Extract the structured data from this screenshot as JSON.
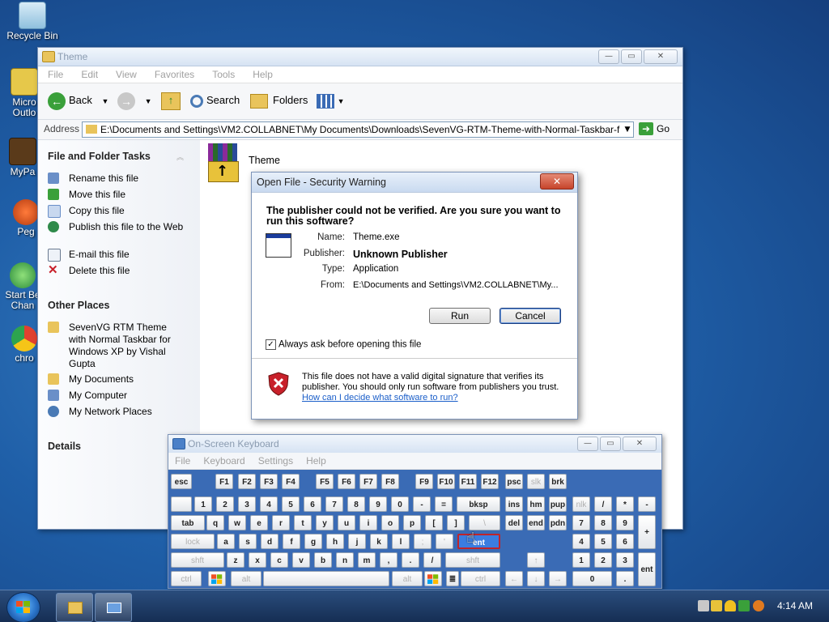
{
  "desktop": {
    "icons": [
      {
        "label": "Recycle Bin"
      },
      {
        "label": "Micro"
      },
      {
        "label": "Outlo"
      },
      {
        "label": "MyPa"
      },
      {
        "label": "Peg"
      },
      {
        "label": "Start Be"
      },
      {
        "label": "Chan"
      },
      {
        "label": "chro"
      }
    ]
  },
  "explorer": {
    "title": "Theme",
    "menu": [
      "File",
      "Edit",
      "View",
      "Favorites",
      "Tools",
      "Help"
    ],
    "toolbar": {
      "back": "Back",
      "search": "Search",
      "folders": "Folders"
    },
    "address": {
      "label": "Address",
      "path": "E:\\Documents and Settings\\VM2.COLLABNET\\My Documents\\Downloads\\SevenVG-RTM-Theme-with-Normal-Taskbar-f",
      "go": "Go"
    },
    "tasks": {
      "heading": "File and Folder Tasks",
      "items": [
        "Rename this file",
        "Move this file",
        "Copy this file",
        "Publish this file to the Web",
        "E-mail this file",
        "Delete this file"
      ]
    },
    "other_places": {
      "heading": "Other Places",
      "items": [
        "SevenVG RTM Theme with Normal Taskbar for Windows XP by Vishal Gupta",
        "My Documents",
        "My Computer",
        "My Network Places"
      ]
    },
    "details": {
      "heading": "Details"
    },
    "file": {
      "name": "Theme"
    }
  },
  "dialog": {
    "title": "Open File - Security Warning",
    "question": "The publisher could not be verified.  Are you sure you want to run this software?",
    "props": [
      {
        "key": "Name:",
        "value": "Theme.exe"
      },
      {
        "key": "Publisher:",
        "value": "Unknown Publisher"
      },
      {
        "key": "Type:",
        "value": "Application"
      },
      {
        "key": "From:",
        "value": "E:\\Documents and Settings\\VM2.COLLABNET\\My..."
      }
    ],
    "run": "Run",
    "cancel": "Cancel",
    "checkbox": "Always ask before opening this file",
    "checkbox_checked": true,
    "warning": "This file does not have a valid digital signature that verifies its publisher. You should only run software from publishers you trust.",
    "link": "How can I decide what software to run?"
  },
  "osk": {
    "title": "On-Screen Keyboard",
    "menu": [
      "File",
      "Keyboard",
      "Settings",
      "Help"
    ],
    "keys": {
      "esc": "esc",
      "f1": "F1",
      "f2": "F2",
      "f3": "F3",
      "f4": "F4",
      "f5": "F5",
      "f6": "F6",
      "f7": "F7",
      "f8": "F8",
      "f9": "F9",
      "f10": "F10",
      "f11": "F11",
      "f12": "F12",
      "psc": "psc",
      "slk": "slk",
      "brk": "brk",
      "n1": "1",
      "n2": "2",
      "n3": "3",
      "n4": "4",
      "n5": "5",
      "n6": "6",
      "n7": "7",
      "n8": "8",
      "n9": "9",
      "n0": "0",
      "minus": "-",
      "equals": "=",
      "bksp": "bksp",
      "ins": "ins",
      "hm": "hm",
      "pup": "pup",
      "nlk": "nlk",
      "slash": "/",
      "star": "*",
      "nminus": "-",
      "tab": "tab",
      "q": "q",
      "w": "w",
      "e": "e",
      "r": "r",
      "t": "t",
      "y": "y",
      "u": "u",
      "i": "i",
      "o": "o",
      "p": "p",
      "lbr": "[",
      "rbr": "]",
      "bslash": "\\",
      "del": "del",
      "end": "end",
      "pdn": "pdn",
      "k7": "7",
      "k8": "8",
      "k9": "9",
      "plus": "+",
      "lock": "lock",
      "a": "a",
      "s": "s",
      "d": "d",
      "f": "f",
      "g": "g",
      "h": "h",
      "j": "j",
      "k": "k",
      "l": "l",
      "semi": ";",
      "quote": "'",
      "ent_main": "ent",
      "k4": "4",
      "k5": "5",
      "k6": "6",
      "lshft": "shft",
      "z": "z",
      "x": "x",
      "c": "c",
      "v": "v",
      "b": "b",
      "n": "n",
      "m": "m",
      "comma": ",",
      "period": ".",
      "fslash": "/",
      "rshft": "shft",
      "up": "↑",
      "k1": "1",
      "k2": "2",
      "k3": "3",
      "ent": "ent",
      "lctrl": "ctrl",
      "lalt": "alt",
      "ralt": "alt",
      "rctrl": "ctrl",
      "left": "←",
      "down": "↓",
      "right": "→",
      "k0": "0",
      "kdot": "."
    }
  },
  "taskbar": {
    "clock": "4:14 AM"
  },
  "colors": {
    "accent": "#3a6bb5",
    "link": "#1a5ec9",
    "desktop": "#1f5fa8"
  }
}
